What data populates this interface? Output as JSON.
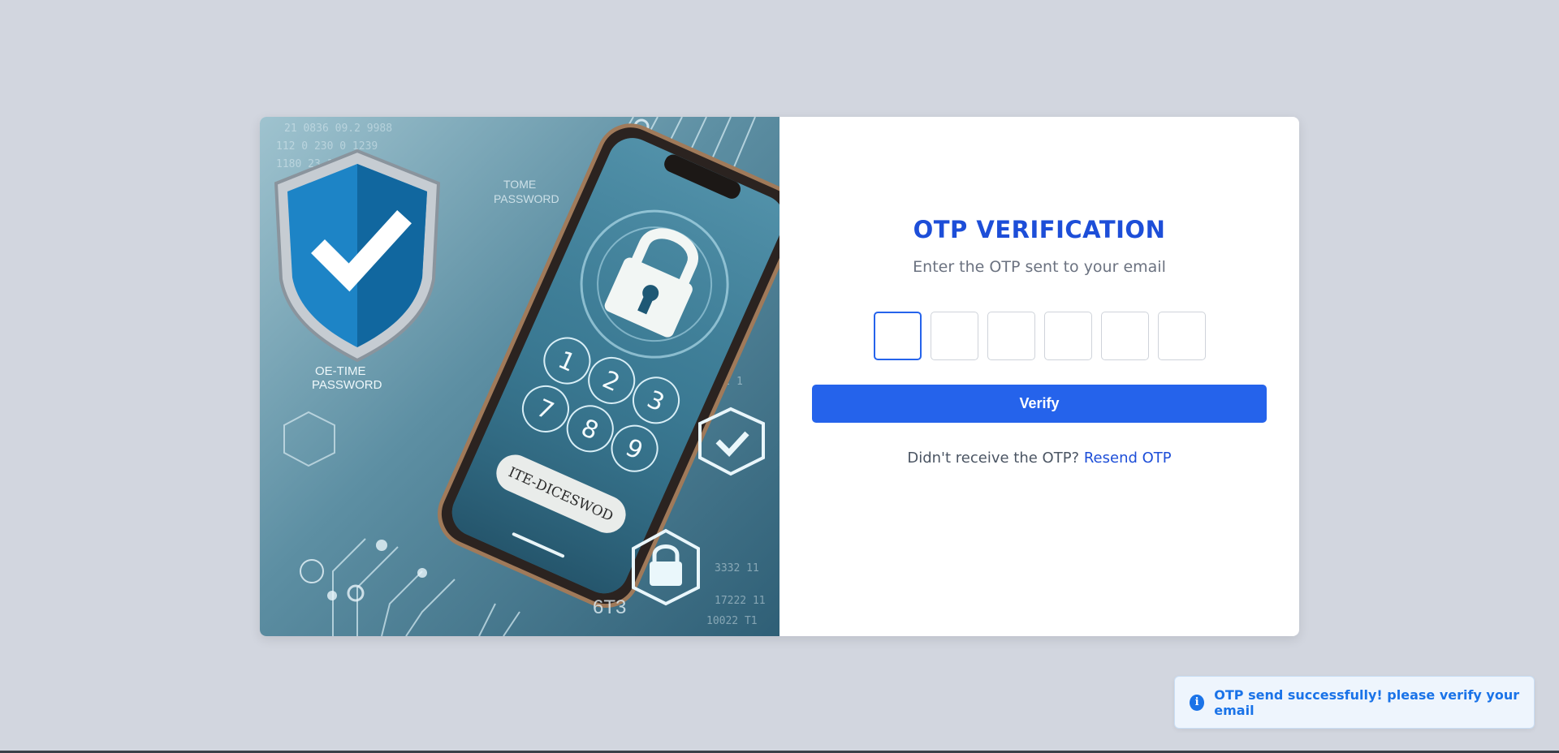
{
  "hero": {
    "image_description_icons": [
      "shield-check-icon",
      "padlock-icon",
      "smartphone-icon"
    ],
    "artwork_text": {
      "shield_caption_line1": "OE-TIME",
      "shield_caption_line2": "PASSWORD",
      "top_text_line1": "TOME",
      "top_text_line2": "PASSWORD",
      "phone_button_text": "ITE-DICESWOD",
      "keypad": [
        "1",
        "2",
        "3",
        "7",
        "8",
        "9"
      ],
      "corner_digits": "6T3"
    }
  },
  "form": {
    "title": "OTP VERIFICATION",
    "subtitle": "Enter the OTP sent to your email",
    "otp_digits": [
      "",
      "",
      "",
      "",
      "",
      ""
    ],
    "verify_label": "Verify",
    "resend_prompt": "Didn't receive the OTP?",
    "resend_link": "Resend OTP"
  },
  "toast": {
    "icon": "info-icon",
    "message": "OTP send successfully! please verify your email"
  },
  "colors": {
    "accent": "#2563eb",
    "title": "#1d4ed8",
    "background": "#d2d6df",
    "toast_text": "#1a73e8"
  }
}
